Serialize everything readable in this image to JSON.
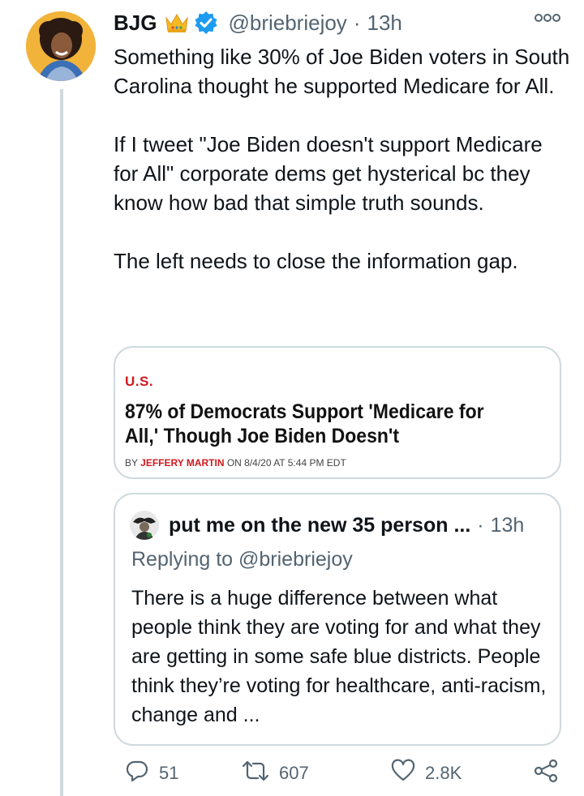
{
  "tweet": {
    "author_name": "BJG",
    "handle": "@briebriejoy",
    "separator": "·",
    "time": "13h",
    "paragraphs": [
      "Something like 30% of Joe Biden voters in South Carolina thought he supported Medicare for All.",
      "If I tweet \"Joe Biden doesn't support Medicare for All\" corporate dems get hysterical bc they know how bad that simple truth sounds.",
      "The left needs to close the information gap."
    ]
  },
  "link_card": {
    "section": "U.S.",
    "headline": "87% of Democrats Support 'Medicare for All,' Though Joe Biden Doesn't",
    "byline_prefix": "BY",
    "byline_author": "JEFFERY MARTIN",
    "byline_suffix": "ON 8/4/20 AT 5:44 PM EDT"
  },
  "quoted_tweet": {
    "author_name": "put me on the new 35 person ...",
    "separator": "·",
    "time": "13h",
    "replying_to": "Replying to @briebriejoy",
    "text": "There is a huge difference between what people think they are voting for and what they are getting in some safe blue districts. People think they’re voting for healthcare, anti-racism, change and ..."
  },
  "actions": {
    "replies": "51",
    "retweets": "607",
    "likes": "2.8K"
  },
  "icons": {
    "crown": "crown-emoji-icon",
    "verified": "verified-badge-icon",
    "more": "more-options-icon",
    "reply": "reply-icon",
    "retweet": "retweet-icon",
    "like": "heart-icon",
    "share": "share-icon"
  },
  "colors": {
    "verified": "#1d9bf0",
    "muted": "#536471",
    "border": "#cfd9de",
    "card_accent": "#d0191d",
    "avatar_bg": "#f2b33a"
  }
}
